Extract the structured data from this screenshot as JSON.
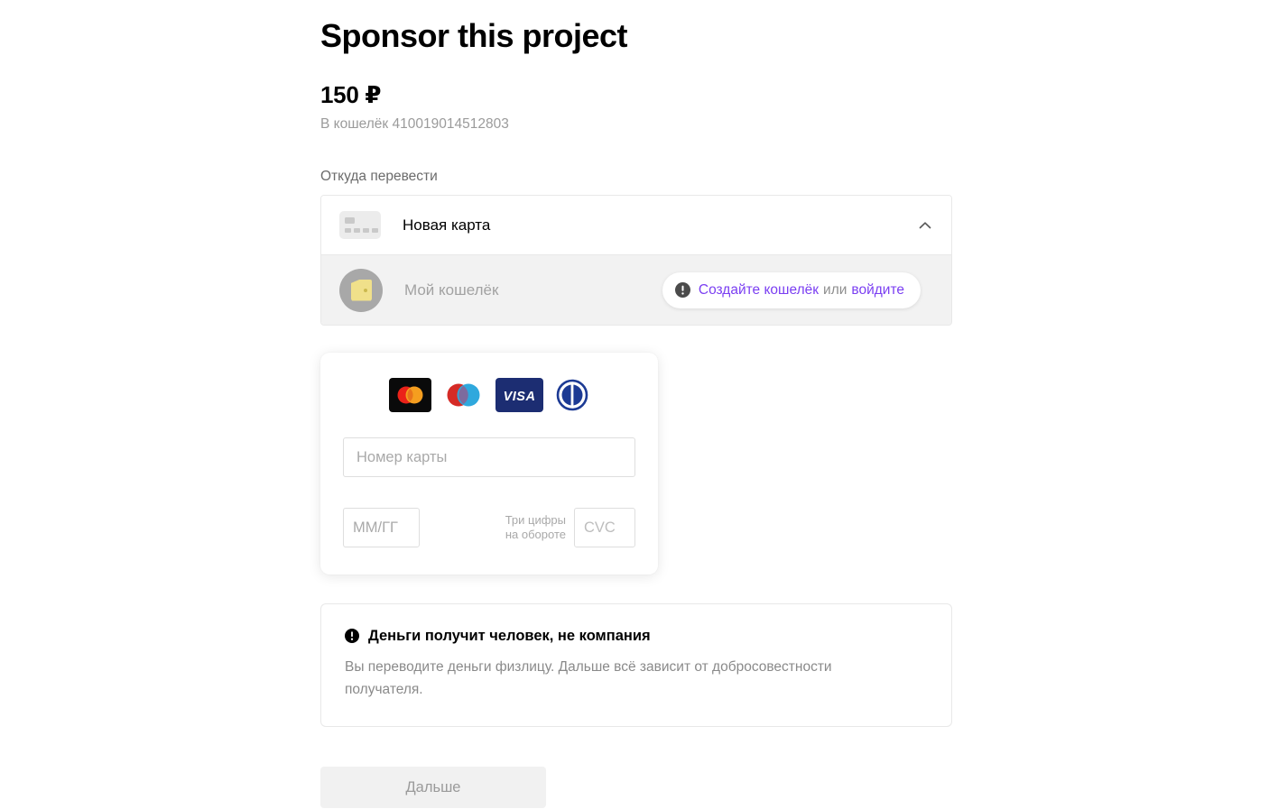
{
  "header": {
    "title": "Sponsor this project",
    "amount": "150 ₽",
    "wallet_line": "В кошелёк 410019014512803"
  },
  "source": {
    "label": "Откуда перевести",
    "options": [
      {
        "name": "Новая карта",
        "icon": "credit-card-icon",
        "selected": true
      },
      {
        "name": "Мой кошелёк",
        "icon": "wallet-icon",
        "disabled": true
      }
    ],
    "expand_icon": "chevron-up-icon",
    "hint": {
      "icon": "exclamation-circle-icon",
      "link_primary": "Создайте кошелёк",
      "separator": "или",
      "link_secondary": "войдите",
      "link_color": "#7b3ff2"
    }
  },
  "card_form": {
    "brands": [
      {
        "name": "mastercard-logo",
        "label": "Mastercard"
      },
      {
        "name": "maestro-logo",
        "label": "Maestro"
      },
      {
        "name": "visa-logo",
        "label": "VISA"
      },
      {
        "name": "diners-club-logo",
        "label": "Diners Club"
      }
    ],
    "card_number_placeholder": "Номер карты",
    "card_number_value": "",
    "expiry_placeholder": "ММ/ГГ",
    "expiry_value": "",
    "cvc_hint": "Три цифры\nна обороте",
    "cvc_placeholder": "CVC",
    "cvc_value": ""
  },
  "notice": {
    "icon": "exclamation-circle-icon",
    "title": "Деньги получит человек, не компания",
    "body": "Вы переводите деньги физлицу. Дальше всё зависит от добросовестности получателя."
  },
  "submit": {
    "label": "Дальше",
    "disabled": true
  }
}
